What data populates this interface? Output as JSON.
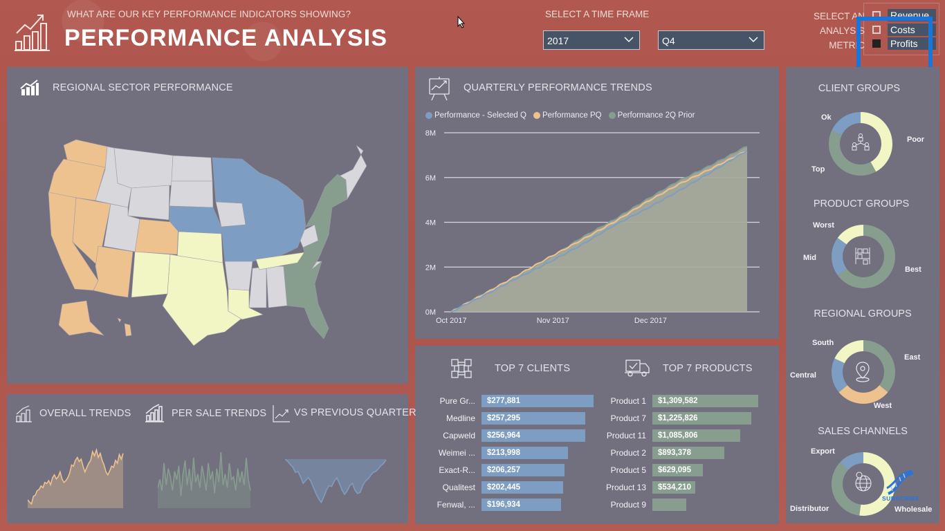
{
  "header": {
    "subtitle": "WHAT ARE OUR KEY PERFORMANCE INDICATORS SHOWING?",
    "title": "PERFORMANCE ANALYSIS",
    "time_frame_label": "SELECT A TIME FRAME",
    "year_dropdown": "2017",
    "quarter_dropdown": "Q4",
    "metric_label_lines": [
      "SELECT AN",
      "ANALYSIS",
      "METRIC"
    ],
    "metric_options": [
      {
        "label": "Revenue",
        "checked": false
      },
      {
        "label": "Costs",
        "checked": false
      },
      {
        "label": "Profits",
        "checked": true
      }
    ]
  },
  "colors": {
    "blue": "#7d9dc3",
    "orange": "#eec28f",
    "green": "#879e8f",
    "yellow": "#f2f5c4",
    "grey": "#d8d8dc",
    "panel": "#72707f",
    "background": "#b15850",
    "focus": "#1a75d8"
  },
  "regional_sector": {
    "title": "REGIONAL SECTOR PERFORMANCE",
    "regions": {
      "West": [
        "WA",
        "OR",
        "CA",
        "NV",
        "AZ",
        "CO",
        "AK",
        "HI"
      ],
      "South": [
        "NM",
        "TX",
        "OK",
        "KS",
        "LA",
        "TN"
      ],
      "Central": [
        "NE",
        "MN",
        "WI",
        "MI",
        "IL",
        "IN",
        "OH",
        "KY",
        "MO"
      ],
      "East": [
        "NY",
        "PA",
        "NJ",
        "MD",
        "VA",
        "NC",
        "GA",
        "FL",
        "MA"
      ]
    }
  },
  "quarterly": {
    "title": "QUARTERLY PERFORMANCE TRENDS",
    "legend": [
      "Performance - Selected Q",
      "Performance PQ",
      "Performance 2Q Prior"
    ]
  },
  "chart_data": [
    {
      "type": "area",
      "title": "QUARTERLY PERFORMANCE TRENDS",
      "x_tick_labels": [
        "Oct 2017",
        "Nov 2017",
        "Dec 2017"
      ],
      "y_tick_labels": [
        "0M",
        "2M",
        "4M",
        "6M",
        "8M"
      ],
      "ylim": [
        0,
        8000000
      ],
      "grid": true,
      "legend_position": "top-left",
      "x_days": [
        0,
        10,
        20,
        30,
        40,
        50,
        60,
        70,
        80,
        91
      ],
      "series": [
        {
          "name": "Performance - Selected Q",
          "color": "#7d9dc3",
          "values": [
            0,
            0.72,
            1.48,
            2.2,
            2.98,
            3.85,
            4.6,
            5.4,
            6.25,
            7.2
          ]
        },
        {
          "name": "Performance PQ",
          "color": "#eec28f",
          "values": [
            0,
            0.78,
            1.6,
            2.42,
            3.2,
            4.0,
            4.9,
            5.7,
            6.4,
            7.2
          ]
        },
        {
          "name": "Performance 2Q Prior",
          "color": "#879e8f",
          "values": [
            0,
            0.8,
            1.58,
            2.35,
            3.3,
            4.1,
            5.0,
            5.85,
            6.55,
            7.4
          ]
        }
      ],
      "value_unit": "M"
    },
    {
      "type": "bar",
      "title": "TOP 7 CLIENTS",
      "categories": [
        "Pure Gr...",
        "Medline",
        "Capweld",
        "Weimei ...",
        "Exact-R...",
        "Qualitest",
        "Fenwal, ..."
      ],
      "values": [
        277881,
        257295,
        256964,
        213998,
        206257,
        202445,
        196934
      ],
      "labels": [
        "$277,881",
        "$257,295",
        "$256,964",
        "$213,998",
        "$206,257",
        "$202,445",
        "$196,934"
      ],
      "color": "#7d9dc3"
    },
    {
      "type": "bar",
      "title": "TOP 7 PRODUCTS",
      "categories": [
        "Product 1",
        "Product 7",
        "Product 11",
        "Product 2",
        "Product 5",
        "Product 13",
        "Product 9"
      ],
      "values": [
        1309582,
        1225826,
        1085806,
        893378,
        629095,
        534210,
        420000
      ],
      "labels": [
        "$1,309,582",
        "$1,225,826",
        "$1,085,806",
        "$893,378",
        "$629,095",
        "$534,210",
        ""
      ],
      "color": "#879e8f"
    },
    {
      "type": "pie",
      "title": "CLIENT GROUPS",
      "categories": [
        "Poor",
        "Top",
        "Ok"
      ],
      "values": [
        42,
        40,
        18
      ],
      "colors": [
        "#f2f5c4",
        "#879e8f",
        "#7d9dc3"
      ]
    },
    {
      "type": "pie",
      "title": "PRODUCT GROUPS",
      "categories": [
        "Best",
        "Mid",
        "Worst"
      ],
      "values": [
        65,
        20,
        15
      ],
      "colors": [
        "#879e8f",
        "#7d9dc3",
        "#f2f5c4"
      ]
    },
    {
      "type": "pie",
      "title": "REGIONAL GROUPS",
      "categories": [
        "East",
        "West",
        "Central",
        "South"
      ],
      "values": [
        36,
        28,
        18,
        18
      ],
      "colors": [
        "#879e8f",
        "#eec28f",
        "#7d9dc3",
        "#f2f5c4"
      ]
    },
    {
      "type": "pie",
      "title": "SALES CHANNELS",
      "categories": [
        "Wholesale",
        "Distributor",
        "Export"
      ],
      "values": [
        52,
        35,
        13
      ],
      "colors": [
        "#f2f5c4",
        "#879e8f",
        "#7d9dc3"
      ]
    },
    {
      "type": "area",
      "title": "OVERALL TRENDS",
      "color": "#eec28f",
      "values": [
        0.12,
        0.08,
        0.05,
        0.18,
        0.2,
        0.28,
        0.3,
        0.36,
        0.33,
        0.42,
        0.4,
        0.45,
        0.38,
        0.5,
        0.55,
        0.48,
        0.52,
        0.6,
        0.48,
        0.42,
        0.45,
        0.5,
        0.58,
        0.72,
        0.7,
        0.8,
        0.85,
        0.78,
        0.82,
        0.7,
        0.6,
        0.68,
        0.75,
        0.8,
        0.95,
        0.88,
        0.98,
        0.85,
        0.92,
        0.8,
        0.72,
        0.6,
        0.55,
        0.62,
        0.7,
        0.68,
        0.8,
        0.75,
        0.9,
        0.82,
        0.92
      ]
    },
    {
      "type": "area",
      "title": "PER SALE TRENDS",
      "color": "#879e8f",
      "values": [
        0.35,
        0.5,
        0.3,
        0.8,
        0.4,
        0.7,
        0.55,
        0.3,
        0.65,
        0.5,
        0.75,
        0.2,
        0.6,
        0.85,
        0.4,
        0.7,
        0.3,
        0.9,
        0.45,
        0.6,
        0.35,
        0.75,
        0.55,
        0.3,
        0.8,
        0.5,
        0.65,
        0.25,
        0.7,
        0.45,
        1.0,
        0.4,
        0.6,
        0.35,
        0.8,
        0.5,
        0.55,
        0.3,
        0.7,
        0.45,
        0.65,
        0.4,
        0.9,
        0.5,
        0.3
      ]
    },
    {
      "type": "area",
      "title": "VS PREVIOUS QUARTER",
      "color": "#7d9dc3",
      "baseline": "top",
      "values": [
        0,
        0.05,
        0.12,
        0.18,
        0.3,
        0.28,
        0.4,
        0.55,
        0.48,
        0.42,
        0.5,
        0.65,
        0.78,
        0.9,
        0.98,
        0.85,
        0.7,
        0.6,
        0.62,
        0.5,
        0.42,
        0.55,
        0.7,
        0.8,
        0.72,
        0.6,
        0.55,
        0.7,
        0.78,
        0.75,
        0.6,
        0.5,
        0.45,
        0.38,
        0.3,
        0.28,
        0.22,
        0.15,
        0.1,
        0.02
      ]
    }
  ],
  "top_clients": {
    "title": "TOP 7 CLIENTS"
  },
  "top_products": {
    "title": "TOP 7 PRODUCTS"
  },
  "trends": {
    "overall": "OVERALL TRENDS",
    "per_sale": "PER SALE TRENDS",
    "vs_previous": "VS PREVIOUS QUARTER"
  },
  "donuts": {
    "client_groups": {
      "title": "CLIENT GROUPS",
      "labels": [
        "Ok",
        "Poor",
        "Top"
      ]
    },
    "product_groups": {
      "title": "PRODUCT GROUPS",
      "labels": [
        "Worst",
        "Mid",
        "Best"
      ]
    },
    "regional_groups": {
      "title": "REGIONAL GROUPS",
      "labels": [
        "South",
        "East",
        "Central",
        "West"
      ]
    },
    "sales_channels": {
      "title": "SALES CHANNELS",
      "labels": [
        "Export",
        "Distributor",
        "Wholesale"
      ]
    }
  },
  "watermark": {
    "text": "SUBSCRIBE"
  }
}
